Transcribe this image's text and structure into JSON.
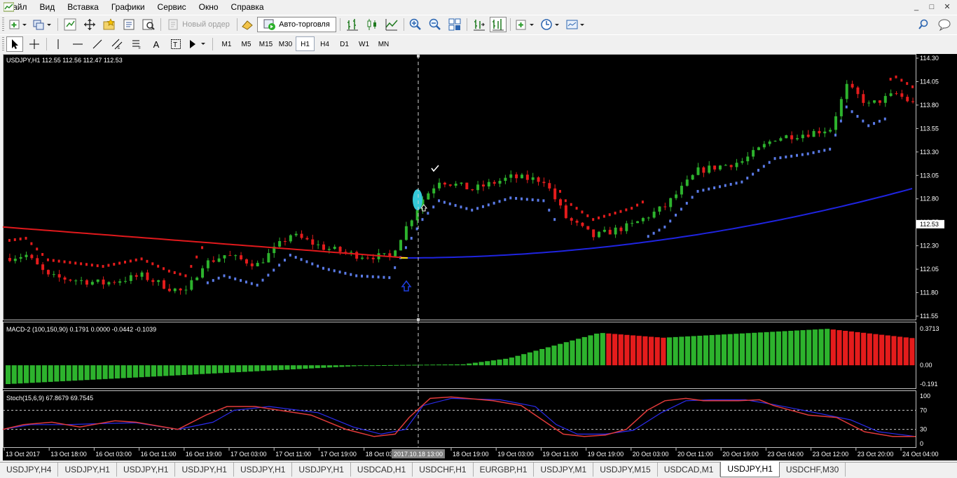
{
  "menu": [
    "Файл",
    "Вид",
    "Вставка",
    "Графики",
    "Сервис",
    "Окно",
    "Справка"
  ],
  "window_controls": [
    "_",
    "□",
    "✕"
  ],
  "toolbar": {
    "new_order_label": "Новый ордер",
    "autotrading_label": "Авто-торговля"
  },
  "timeframes": [
    "M1",
    "M5",
    "M15",
    "M30",
    "H1",
    "H4",
    "D1",
    "W1",
    "MN"
  ],
  "active_timeframe": "H1",
  "chart": {
    "title": "USDJPY,H1  112.55 112.56 112.47 112.53",
    "current_price": "112.53",
    "price_axis": [
      "114.30",
      "114.05",
      "113.80",
      "113.55",
      "113.30",
      "113.05",
      "112.80",
      "112.55",
      "112.30",
      "112.05",
      "111.80",
      "111.55"
    ],
    "time_axis": [
      "13 Oct 2017",
      "13 Oct 18:00",
      "16 Oct 03:00",
      "16 Oct 11:00",
      "16 Oct 19:00",
      "17 Oct 03:00",
      "17 Oct 11:00",
      "17 Oct 19:00",
      "18 Oct 03:00",
      "18 Oct 19:00",
      "19 Oct 03:00",
      "19 Oct 11:00",
      "19 Oct 19:00",
      "20 Oct 03:00",
      "20 Oct 11:00",
      "20 Oct 19:00",
      "23 Oct 04:00",
      "23 Oct 12:00",
      "23 Oct 20:00",
      "24 Oct 04:00"
    ],
    "crosshair_time": "2017.10.18 13:00",
    "colors": {
      "bull": "#2db32d",
      "bear": "#e41c1c",
      "ma_red": "#e0191c",
      "ma_blue": "#1f24e0",
      "trail": "#5a7ae6"
    }
  },
  "macd": {
    "label": "MACD-2 (100,150,90) 0.1791 0.0000 -0.0442 -0.1039",
    "axis": [
      "0.3713",
      "0.00",
      "-0.191"
    ]
  },
  "stoch": {
    "label": "Stoch(15,6,9) 67.8679 69.7545",
    "axis": [
      "100",
      "70",
      "30",
      "0"
    ]
  },
  "tabs": [
    "USDJPY,H4",
    "USDJPY,H1",
    "USDJPY,H1",
    "USDJPY,H1",
    "USDJPY,H1",
    "USDJPY,H1",
    "USDCAD,H1",
    "USDCHF,H1",
    "EURGBP,H1",
    "USDJPY,M1",
    "USDJPY,M15",
    "USDCAD,M1",
    "USDJPY,H1",
    "USDCHF,M30"
  ],
  "active_tab": 12
}
